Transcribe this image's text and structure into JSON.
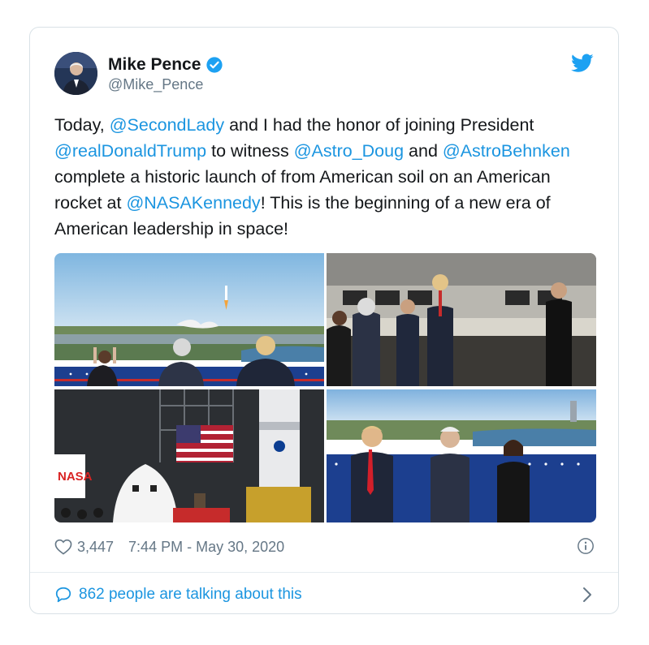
{
  "tweet": {
    "author_name": "Mike Pence",
    "handle": "@Mike_Pence",
    "text_parts": [
      {
        "t": "Today, "
      },
      {
        "t": "@SecondLady",
        "link": true
      },
      {
        "t": " and I had the honor of joining President "
      },
      {
        "t": "@realDonaldTrump",
        "link": true
      },
      {
        "t": " to witness "
      },
      {
        "t": "@Astro_Doug",
        "link": true
      },
      {
        "t": " and "
      },
      {
        "t": "@AstroBehnken",
        "link": true
      },
      {
        "t": " complete a historic launch of from American soil on an American rocket at "
      },
      {
        "t": "@NASAKennedy",
        "link": true
      },
      {
        "t": "! This is the beginning of a new era of American leadership in space!"
      }
    ],
    "likes": "3,447",
    "timestamp": "7:44 PM - May 30, 2020",
    "talking": "862 people are talking about this",
    "nasa_wordmark": "NASA"
  },
  "icons": {
    "verified": "verified-badge-icon",
    "brand": "twitter-bird-icon",
    "like": "heart-icon",
    "info": "info-icon",
    "reply": "speech-bubble-icon",
    "chevron": "chevron-right-icon"
  },
  "colors": {
    "link": "#1b95e0",
    "text": "#14171a",
    "muted": "#657786",
    "border": "#d9e1e6"
  }
}
